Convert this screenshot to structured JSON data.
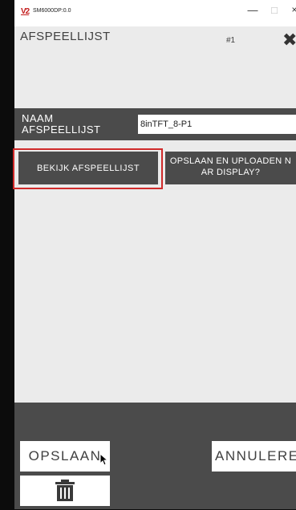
{
  "window": {
    "title": "SM6000DP:0.0",
    "minimize_glyph": "—",
    "maximize_glyph": "□",
    "close_glyph": "×",
    "icon_glyph": "V2"
  },
  "header": {
    "title": "AFSPEELLIJST",
    "number": "#1",
    "close_glyph": "✖"
  },
  "form": {
    "name_label": "NAAM AFSPEELLIJST",
    "name_value": "8inTFT_8-P1"
  },
  "actions": {
    "view_label": "BEKIJK AFSPEELLIJST",
    "upload_line1": "OPSLAAN EN UPLOADEN N",
    "upload_line2": "AR DISPLAY?"
  },
  "footer": {
    "save_label": "OPSLAAN",
    "cancel_label": "ANNULEREN",
    "delete_icon": "trash-icon"
  },
  "colors": {
    "panel": "#4b4b4b",
    "background": "#ebebeb",
    "highlight": "#d02a2a",
    "frame": "#0c0c0c"
  }
}
